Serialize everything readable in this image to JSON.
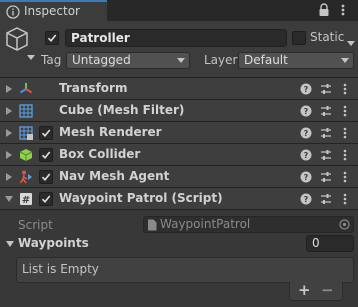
{
  "tab": {
    "title": "Inspector",
    "icon": "info-icon"
  },
  "header": {
    "object_name": "Patroller",
    "active": true,
    "static_label": "Static",
    "tag_label": "Tag",
    "tag_value": "Untagged",
    "layer_label": "Layer",
    "layer_value": "Default"
  },
  "components": [
    {
      "name": "Transform",
      "icon": "transform-icon",
      "has_checkbox": false
    },
    {
      "name": "Cube (Mesh Filter)",
      "icon": "mesh-filter-icon",
      "has_checkbox": false
    },
    {
      "name": "Mesh Renderer",
      "icon": "mesh-renderer-icon",
      "has_checkbox": true,
      "enabled": true
    },
    {
      "name": "Box Collider",
      "icon": "box-collider-icon",
      "has_checkbox": true,
      "enabled": true
    },
    {
      "name": "Nav Mesh Agent",
      "icon": "nav-mesh-agent-icon",
      "has_checkbox": true,
      "enabled": true
    },
    {
      "name": "Waypoint Patrol (Script)",
      "icon": "script-icon",
      "has_checkbox": true,
      "enabled": true,
      "expanded": true
    }
  ],
  "script_field": {
    "label": "Script",
    "value": "WaypointPatrol"
  },
  "waypoints": {
    "label": "Waypoints",
    "count": "0",
    "empty_text": "List is Empty",
    "add": "+",
    "remove": "−"
  },
  "colors": {
    "accent": "#3a79bb",
    "background": "#383838",
    "component_header": "#3e3e3e"
  }
}
